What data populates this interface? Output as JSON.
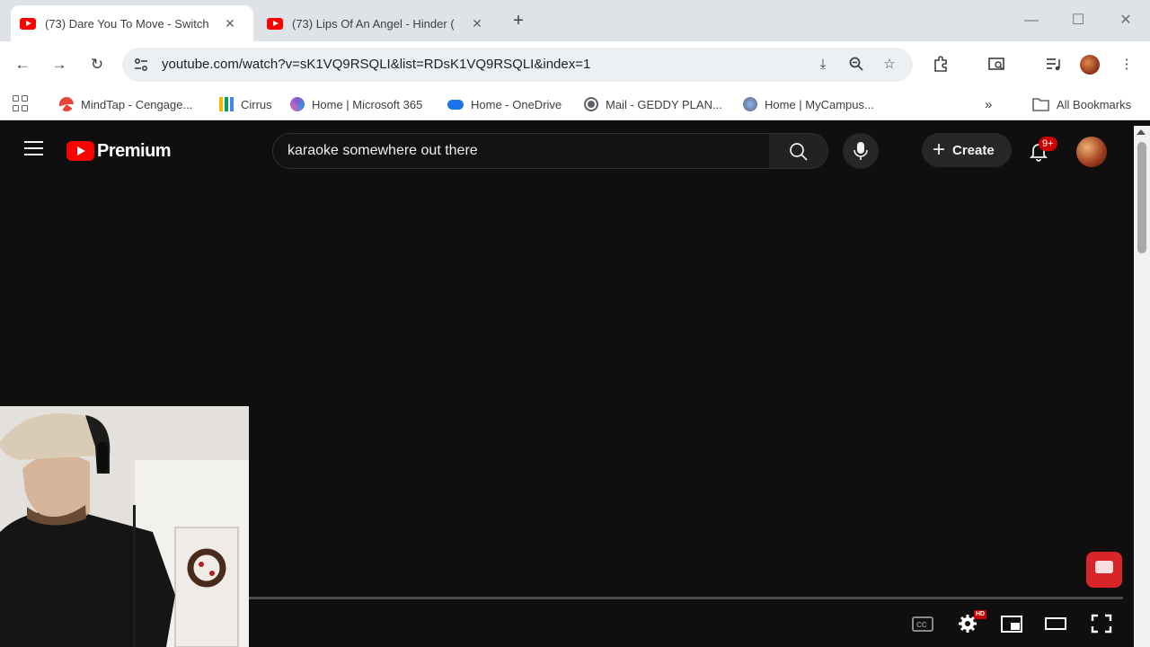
{
  "browser": {
    "tabs": [
      {
        "title": "(73) Dare You To Move - Switch",
        "active": true
      },
      {
        "title": "(73) Lips Of An Angel - Hinder (",
        "active": false
      }
    ],
    "url": "youtube.com/watch?v=sK1VQ9RSQLI&list=RDsK1VQ9RSQLI&index=1",
    "bookmarks": [
      {
        "label": "MindTap - Cengage...",
        "icon": "mindtap-icon"
      },
      {
        "label": "Cirrus",
        "icon": "cirrus-icon"
      },
      {
        "label": "Home | Microsoft 365",
        "icon": "microsoft365-icon"
      },
      {
        "label": "Home - OneDrive",
        "icon": "onedrive-icon"
      },
      {
        "label": "Mail - GEDDY PLAN...",
        "icon": "globe-icon"
      },
      {
        "label": "Home | MyCampus...",
        "icon": "globe-icon"
      }
    ],
    "all_bookmarks_label": "All Bookmarks"
  },
  "youtube": {
    "logo_text": "Premium",
    "search_query": "karaoke somewhere out there",
    "create_label": "Create",
    "notification_badge": "9+"
  },
  "player": {
    "hd_badge": "HD"
  },
  "colors": {
    "youtube_red": "#ff0000",
    "page_bg": "#0f0f0f",
    "chrome_frame": "#dfe3e8"
  }
}
